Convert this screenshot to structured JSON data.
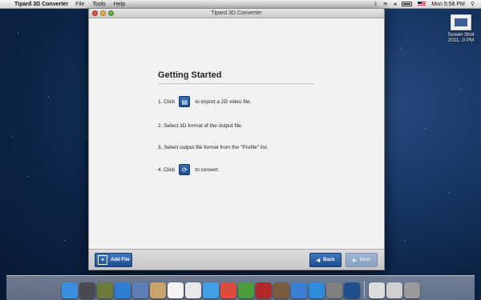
{
  "menubar": {
    "app_name": "Tipard 3D Converter",
    "menus": [
      "File",
      "Tools",
      "Help"
    ],
    "clock": "Mon 5:58 PM",
    "status_icons": [
      "bluetooth-icon",
      "wifi-icon",
      "volume-icon",
      "battery-icon",
      "flag-icon",
      "search-icon"
    ]
  },
  "desktop": {
    "item_label": "Screen Shot 2011...0 PM"
  },
  "window": {
    "title": "Tipard 3D Converter",
    "getting_started": {
      "heading": "Getting Started",
      "step1_prefix": "1. Click",
      "step1_suffix": "to import a 2D video file.",
      "step2": "2. Select 3D format of the output file.",
      "step3": "3. Select output file format from the \"Profile\" list.",
      "step4_prefix": "4. Click",
      "step4_suffix": "to convert."
    },
    "bottom": {
      "add_file_label": "Add File",
      "back_label": "Back",
      "next_label": "Next"
    }
  },
  "dock": {
    "apps": [
      {
        "name": "finder",
        "color": "#3b8fe0"
      },
      {
        "name": "launchpad",
        "color": "#4a4a52"
      },
      {
        "name": "mission-control",
        "color": "#6b7c3a"
      },
      {
        "name": "safari",
        "color": "#2f7fd6"
      },
      {
        "name": "preview",
        "color": "#5c7fb8"
      },
      {
        "name": "mail",
        "color": "#c9a36a"
      },
      {
        "name": "calendar",
        "color": "#f4f4f4"
      },
      {
        "name": "reminders",
        "color": "#e8e8e8"
      },
      {
        "name": "messages",
        "color": "#3fa0e8"
      },
      {
        "name": "chrome",
        "color": "#dd4b3e"
      },
      {
        "name": "facetime",
        "color": "#4a9a3e"
      },
      {
        "name": "photo-booth",
        "color": "#b02a2a"
      },
      {
        "name": "photos",
        "color": "#7a5c3e"
      },
      {
        "name": "itunes",
        "color": "#3a7fd5"
      },
      {
        "name": "app-store",
        "color": "#2e8bdc"
      },
      {
        "name": "system-preferences",
        "color": "#808080"
      },
      {
        "name": "3d-converter",
        "color": "#1f4e8c"
      }
    ],
    "right_items": [
      {
        "name": "downloads",
        "color": "#dcdcdc"
      },
      {
        "name": "documents",
        "color": "#cfcfcf"
      },
      {
        "name": "trash",
        "color": "#9a9a9a"
      }
    ]
  }
}
